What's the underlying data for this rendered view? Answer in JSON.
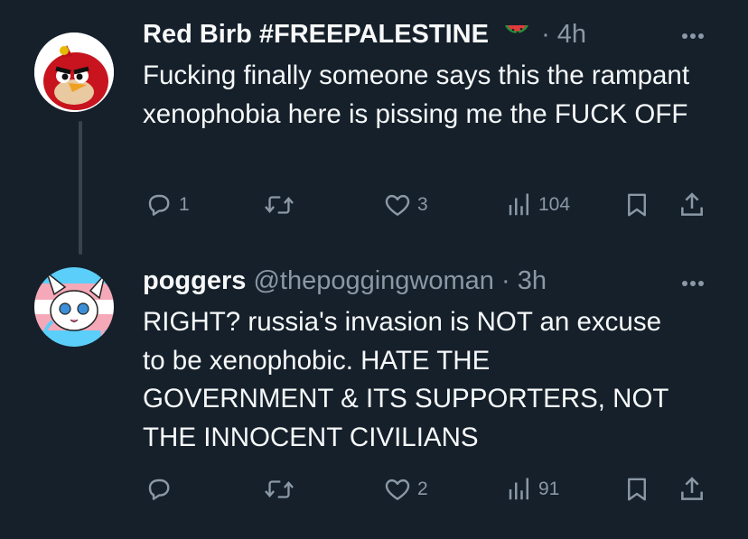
{
  "tweets": [
    {
      "display_name": "Red Birb #FREEPALESTINE",
      "handle": "",
      "time": "· 4h",
      "text": "Fucking finally someone says this the rampant xenophobia here is pissing me the FUCK OFF",
      "counts": {
        "replies": "1",
        "retweets": "",
        "likes": "3",
        "views": "104"
      },
      "icons": [
        "reply-icon",
        "retweet-icon",
        "like-icon",
        "views-icon",
        "bookmark-icon",
        "share-icon",
        "more-icon"
      ]
    },
    {
      "display_name": "poggers",
      "handle": "@thepoggingwoman",
      "time": "· 3h",
      "text": "RIGHT? russia's invasion is NOT an excuse to be xenophobic. HATE THE GOVERNMENT & ITS SUPPORTERS, NOT THE INNOCENT CIVILIANS",
      "counts": {
        "replies": "",
        "retweets": "",
        "likes": "2",
        "views": "91"
      },
      "icons": [
        "reply-icon",
        "retweet-icon",
        "like-icon",
        "views-icon",
        "bookmark-icon",
        "share-icon",
        "more-icon"
      ]
    }
  ],
  "colors": {
    "background": "#15202b",
    "text": "#f7f9f9",
    "muted": "#8b98a5",
    "thread_line": "#38444d"
  }
}
